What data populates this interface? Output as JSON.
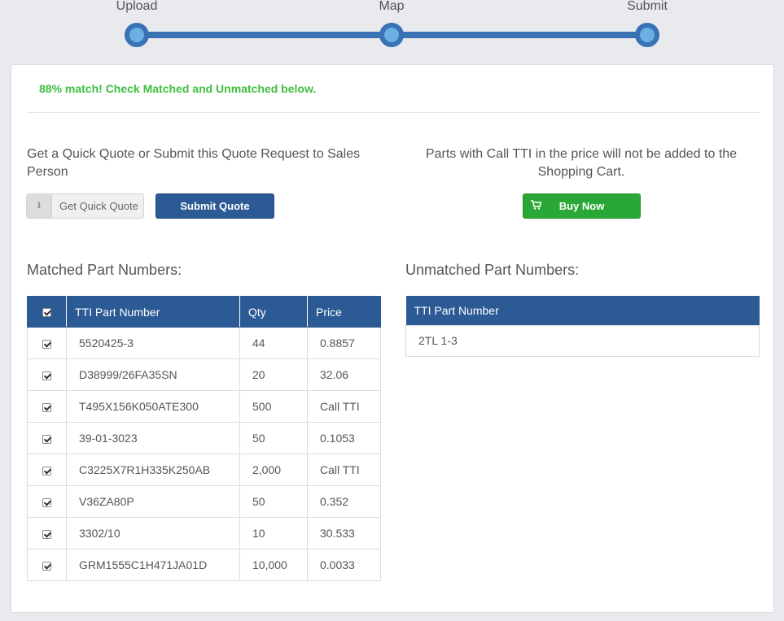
{
  "stepper": {
    "steps": [
      "Upload",
      "Map",
      "Submit"
    ]
  },
  "match": {
    "message": "88% match! Check Matched and Unmatched below."
  },
  "quote": {
    "text": "Get a Quick Quote or Submit this Quote Request to Sales Person",
    "quick_quote_label": "Get Quick Quote",
    "submit_label": "Submit Quote"
  },
  "cart": {
    "text": "Parts with Call TTI in the price will not be added to the Shopping Cart.",
    "buy_label": "Buy Now"
  },
  "matched": {
    "title": "Matched Part Numbers:",
    "headers": [
      "TTI Part Number",
      "Qty",
      "Price"
    ],
    "rows": [
      {
        "part": "5520425-3",
        "qty": "44",
        "price": "0.8857",
        "checked": true
      },
      {
        "part": "D38999/26FA35SN",
        "qty": "20",
        "price": "32.06",
        "checked": true
      },
      {
        "part": "T495X156K050ATE300",
        "qty": "500",
        "price": "Call TTI",
        "checked": true
      },
      {
        "part": "39-01-3023",
        "qty": "50",
        "price": "0.1053",
        "checked": true
      },
      {
        "part": "C3225X7R1H335K250AB",
        "qty": "2,000",
        "price": "Call TTI",
        "checked": true
      },
      {
        "part": "V36ZA80P",
        "qty": "50",
        "price": "0.352",
        "checked": true
      },
      {
        "part": "3302/10",
        "qty": "10",
        "price": "30.533",
        "checked": true
      },
      {
        "part": "GRM1555C1H471JA01D",
        "qty": "10,000",
        "price": "0.0033",
        "checked": true
      }
    ]
  },
  "unmatched": {
    "title": "Unmatched Part Numbers:",
    "header": "TTI Part Number",
    "rows": [
      "2TL 1-3"
    ]
  },
  "colors": {
    "primary": "#2b5a95",
    "success": "#2aa837",
    "match_text": "#3fbf3f",
    "link": "#3a7fc1"
  }
}
